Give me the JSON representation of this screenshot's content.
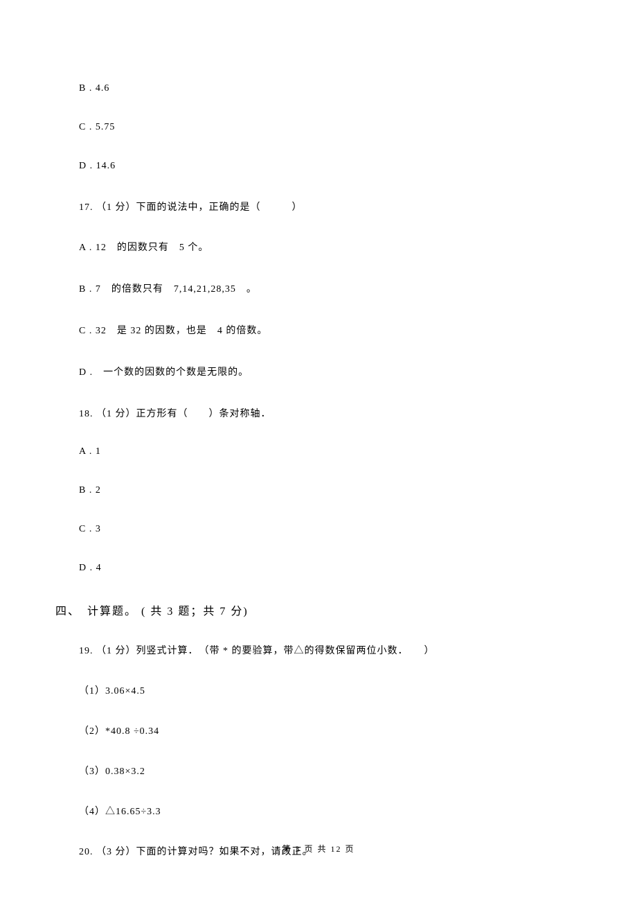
{
  "options_top": {
    "b": "B . 4.6",
    "c": "C . 5.75",
    "d": "D . 14.6"
  },
  "q17": {
    "stem": "17. （1 分）下面的说法中，正确的是（　　　）",
    "a": "A . 12　的因数只有　5 个。",
    "b": "B . 7　的倍数只有　7,14,21,28,35　。",
    "c": "C . 32　是 32 的因数，也是　4 的倍数。",
    "d": "D .　一个数的因数的个数是无限的。"
  },
  "q18": {
    "stem": "18. （1 分）正方形有（　　）条对称轴．",
    "a": "A . 1",
    "b": "B . 2",
    "c": "C . 3",
    "d": "D . 4"
  },
  "section4": "四、　计算题。  ( 共 3 题；共 7 分)",
  "q19": {
    "stem": "19. （1 分）列竖式计算．　（带 * 的要验算，带△的得数保留两位小数．　　）",
    "p1": "（1）3.06×4.5",
    "p2": "（2）*40.8 ÷0.34",
    "p3": "（3）0.38×3.2",
    "p4": "（4）△16.65÷3.3"
  },
  "q20": {
    "stem": "20. （3 分）下面的计算对吗？如果不对，请改正。"
  },
  "footer": "第 3 页 共 12 页"
}
